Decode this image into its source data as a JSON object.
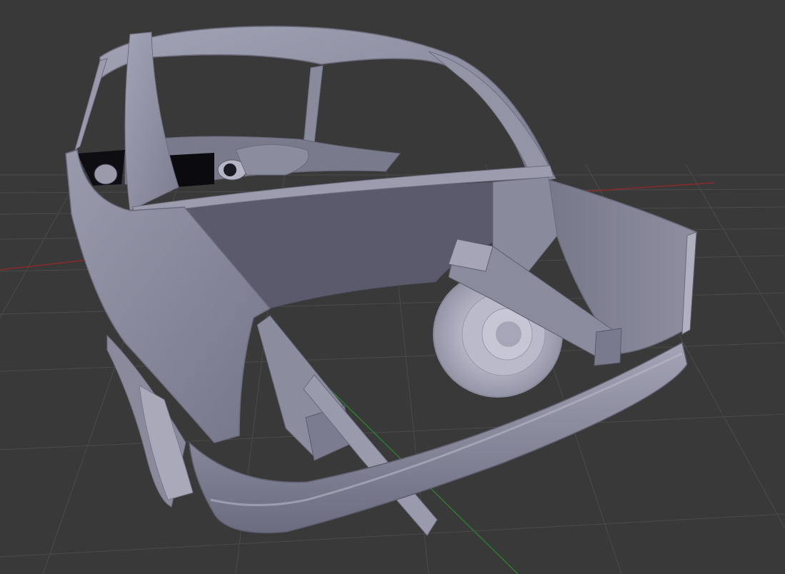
{
  "viewport": {
    "background_color": "#393939",
    "grid_color": "#4a4a4a",
    "x_axis_color": "#8b2a2a",
    "y_axis_color": "#2f7a2f",
    "model_color": "#8d8d9e"
  }
}
